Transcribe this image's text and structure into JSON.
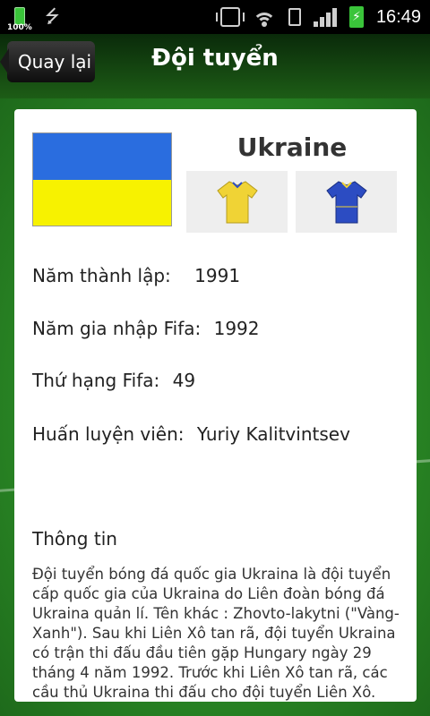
{
  "status_bar": {
    "battery_percent": "100%",
    "time": "16:49"
  },
  "header": {
    "back_label": "Quay lại",
    "title": "Đội tuyển"
  },
  "team": {
    "name": "Ukraine",
    "flag_colors": [
      "#2a6ddf",
      "#f7f200"
    ],
    "home_kit_color": "#f0d335",
    "away_kit_color": "#2c4cc2"
  },
  "info": {
    "founded_label": "Năm thành lập:",
    "founded_value": "1991",
    "joined_label": "Năm gia nhập Fifa:",
    "joined_value": "1992",
    "rank_label": "Thứ hạng Fifa:",
    "rank_value": "49",
    "coach_label": "Huấn luyện viên:",
    "coach_value": "Yuriy Kalitvintsev"
  },
  "about": {
    "title": "Thông tin",
    "text": "Đội tuyển bóng đá quốc gia Ukraina là đội tuyển cấp quốc gia của Ukraina do Liên đoàn bóng đá Ukraina quản lí. Tên khác : Zhovto-lakytni (\"Vàng-Xanh\"). Sau khi Liên Xô tan rã, đội tuyển Ukraina có trận thi đấu đầu tiên gặp Hungary ngày 29 tháng 4 năm 1992. Trước khi Liên Xô tan rã, các cầu thủ Ukraina thi đấu cho đội tuyển Liên Xô."
  }
}
